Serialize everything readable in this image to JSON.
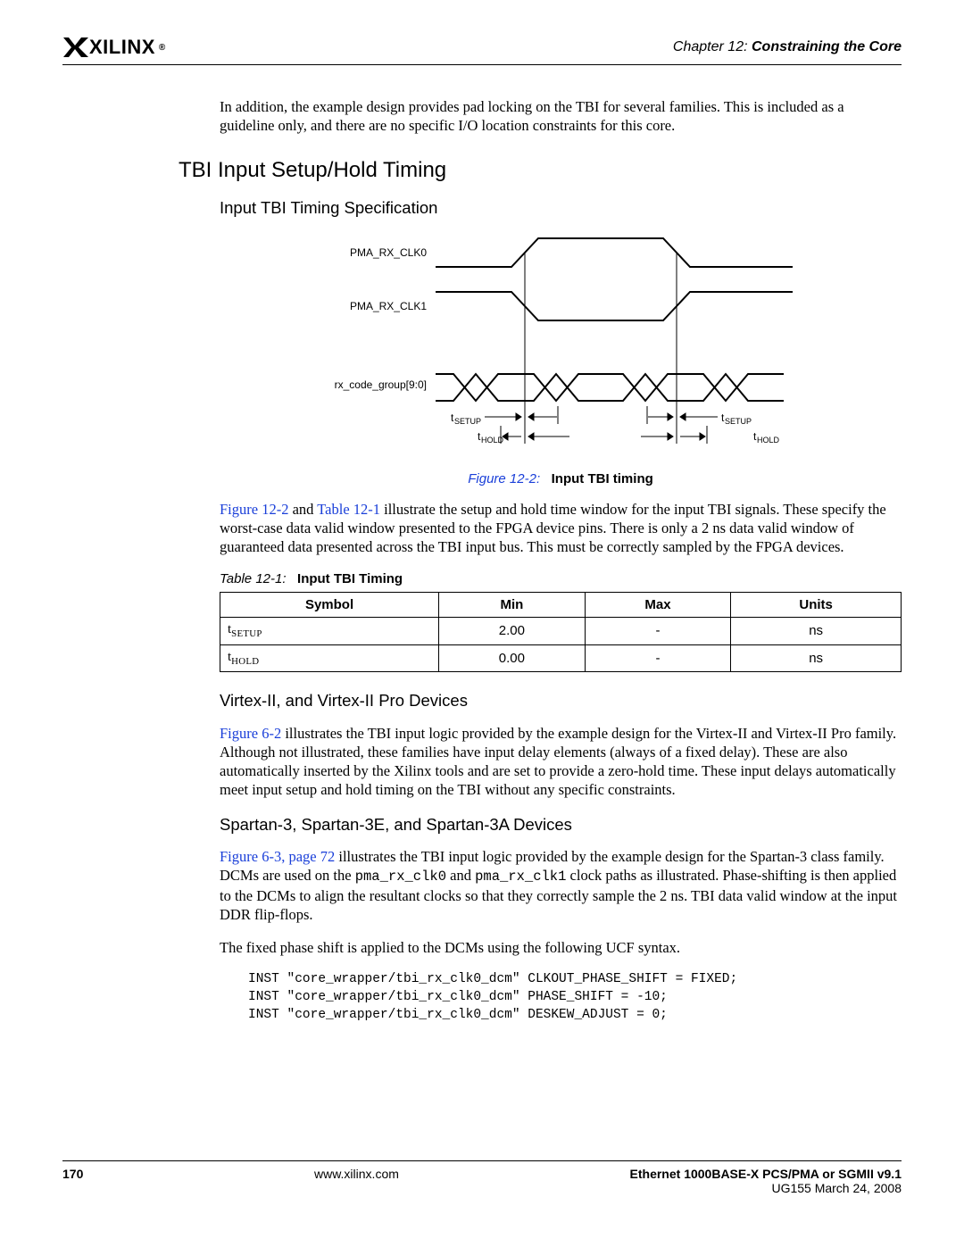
{
  "header": {
    "logo_text": "XILINX",
    "logo_reg": "®",
    "chapter_label": "Chapter 12:",
    "chapter_title": "Constraining the Core"
  },
  "intro_para": "In addition, the example design provides pad locking on the TBI for several families.  This is included as a guideline only, and there are no specific I/O location constraints for this core.",
  "section_heading": "TBI Input Setup/Hold Timing",
  "subsection_spec": "Input TBI Timing Specification",
  "figure": {
    "number": "Figure 12-2:",
    "title": "Input TBI timing",
    "labels": {
      "clk0": "PMA_RX_CLK0",
      "clk1": "PMA_RX_CLK1",
      "data": "rx_code_group[9:0]",
      "tsetup": "SETUP",
      "thold": "HOLD"
    }
  },
  "para_after_fig_a": "Figure 12-2",
  "para_after_fig_b": " and ",
  "para_after_fig_c": "Table 12-1",
  "para_after_fig_d": " illustrate the setup and hold time window for the input TBI signals. These specify the worst-case data valid window presented to the FPGA device pins. There is only a 2 ns data valid window of guaranteed data presented across the TBI input bus. This must be correctly sampled by the FPGA devices.",
  "table": {
    "number": "Table 12-1:",
    "title": "Input TBI Timing",
    "headers": [
      "Symbol",
      "Min",
      "Max",
      "Units"
    ],
    "rows": [
      {
        "symbol_t": "t",
        "symbol_sub": "SETUP",
        "min": "2.00",
        "max": "-",
        "units": "ns"
      },
      {
        "symbol_t": "t",
        "symbol_sub": "HOLD",
        "min": "0.00",
        "max": "-",
        "units": "ns"
      }
    ]
  },
  "virtex": {
    "heading": "Virtex-II, and Virtex-II Pro Devices",
    "link": "Figure 6-2",
    "body": " illustrates the TBI input logic provided by the example design for the Virtex-II and Virtex-II Pro family. Although not illustrated, these families have input delay elements (always of a fixed delay). These are also automatically inserted by the Xilinx tools and are set to provide a zero-hold time. These input delays automatically meet input setup and hold timing on the TBI without any specific constraints."
  },
  "spartan": {
    "heading": "Spartan-3, Spartan-3E, and Spartan-3A Devices",
    "link": "Figure 6-3, page 72",
    "body_a": " illustrates the TBI input logic provided by the example design for the Spartan-3 class family. DCMs are used on the ",
    "mono1": "pma_rx_clk0",
    "body_b": " and ",
    "mono2": "pma_rx_clk1",
    "body_c": "  clock paths as illustrated. Phase-shifting is then applied to the DCMs to align the resultant clocks so that they correctly sample the 2 ns. TBI data valid window at the input DDR flip-flops.",
    "para2": "The fixed phase shift is applied to the DCMs using the following UCF syntax.",
    "code": "INST \"core_wrapper/tbi_rx_clk0_dcm\" CLKOUT_PHASE_SHIFT = FIXED;\nINST \"core_wrapper/tbi_rx_clk0_dcm\" PHASE_SHIFT = -10;\nINST \"core_wrapper/tbi_rx_clk0_dcm\" DESKEW_ADJUST = 0;"
  },
  "footer": {
    "page": "170",
    "url": "www.xilinx.com",
    "doc_title": "Ethernet 1000BASE-X PCS/PMA or SGMII v9.1",
    "doc_sub": "UG155 March 24, 2008"
  }
}
